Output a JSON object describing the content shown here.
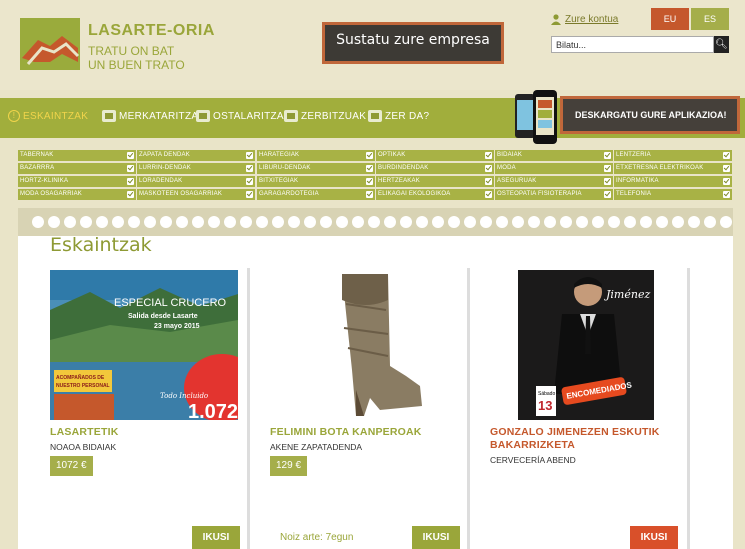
{
  "brand": {
    "title": "LASARTE-ORIA",
    "tagline_1": "TRATU ON BAT",
    "tagline_2": "UN BUEN TRATO"
  },
  "promo": {
    "label": "Sustatu zure empresa"
  },
  "account": {
    "link": "Zure kontua"
  },
  "languages": [
    "EU",
    "ES"
  ],
  "search": {
    "placeholder": "Bilatu..."
  },
  "nav": [
    {
      "label": "ESKAINTZAK",
      "icon": "info-icon",
      "active": true
    },
    {
      "label": "MERKATARITZA",
      "icon": "shop-icon",
      "active": false
    },
    {
      "label": "OSTALARITZA",
      "icon": "restaurant-icon",
      "active": false
    },
    {
      "label": "ZERBITZUAK",
      "icon": "services-icon",
      "active": false
    },
    {
      "label": "ZER DA?",
      "icon": "question-icon",
      "active": false
    }
  ],
  "app_banner": {
    "label": "DESKARGATU GURE APLIKAZIOA!"
  },
  "categories": [
    [
      "TABERNAK",
      "ZAPATA DENDAK",
      "HARATEGIAK",
      "OPTIKAK",
      "BIDAIAK",
      "LENTZERIA"
    ],
    [
      "BAZARRRA",
      "LURRIN-DENDAK",
      "LIBURU-DENDAK",
      "BURDINDENDAK",
      "MODA",
      "ETXETRESNA ELEKTRIKOAK"
    ],
    [
      "HORTZ-KLINIKA",
      "LORADENDAK",
      "BITXITEGIAK",
      "HERTZEAKAK",
      "ASEGURUAK",
      "INFORMATIKA"
    ],
    [
      "MODA OSAGARRIAK",
      "MASKOTEEN OSAGARRIAK",
      "GARAGARDOTEGIA",
      "ELIKAGAI EKOLOGIKOA",
      "OSTEOPATIA FISIOTERAPIA",
      "TELEFONIA"
    ]
  ],
  "section": {
    "title": "Eskaintzak"
  },
  "offers": [
    {
      "title_1": "LASARTETIK",
      "title_2": "",
      "shop": "NOAOA BIDAIAK",
      "price": "1072 €",
      "until": "",
      "button": "IKUSI",
      "image": {
        "line_1": "ESPECIAL CRUCERO",
        "line_2": "Salida desde Lasarte",
        "line_3": "23 mayo 2015",
        "badge": "ACOMPAÑADOS DE NUESTRO PERSONAL",
        "price": "1.072€",
        "caption": "Todo Incluido"
      }
    },
    {
      "title_1": "FELIMINI BOTA KANPEROAK",
      "title_2": "",
      "shop": "AKENE ZAPATADENDA",
      "price": "129 €",
      "until": "Noiz arte: 7egun",
      "button": "IKUSI"
    },
    {
      "title_1": "GONZALO JIMENEZEN ESKUTIK",
      "title_2": "BAKARRIZKETA",
      "shop": "CERVECERÍA ABEND",
      "price": "",
      "until": "",
      "button": "IKUSI",
      "image": {
        "name": "Jiménez",
        "day": "Sábado",
        "date": "13",
        "stamp": "ENCOMEDIADOS"
      }
    }
  ],
  "colors": {
    "olive": "#a1ae3c",
    "orange": "#c5582c",
    "beige": "#e9e4c8"
  }
}
